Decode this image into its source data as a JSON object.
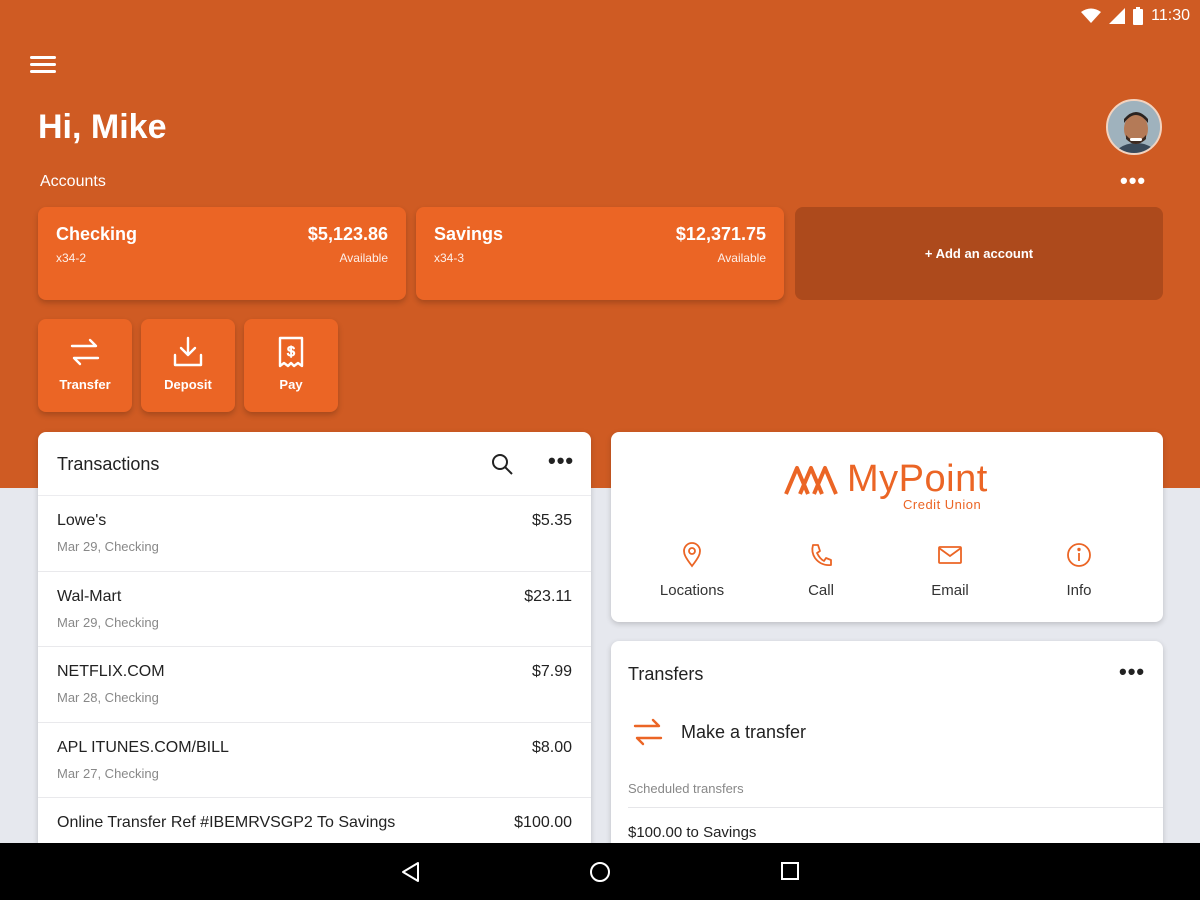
{
  "status_bar": {
    "time": "11:30",
    "icons": [
      "wifi-icon",
      "signal-icon",
      "battery-icon"
    ]
  },
  "header": {
    "greeting": "Hi, Mike",
    "menu_icon": "menu-icon",
    "avatar": "user-avatar"
  },
  "accounts": {
    "label": "Accounts",
    "more_icon": "more-horizontal-icon",
    "items": [
      {
        "name": "Checking",
        "number": "x34-2",
        "balance": "$5,123.86",
        "status": "Available"
      },
      {
        "name": "Savings",
        "number": "x34-3",
        "balance": "$12,371.75",
        "status": "Available"
      }
    ],
    "add_label": "+ Add an account"
  },
  "quick_actions": [
    {
      "label": "Transfer",
      "icon": "transfer-icon"
    },
    {
      "label": "Deposit",
      "icon": "deposit-icon"
    },
    {
      "label": "Pay",
      "icon": "bill-pay-icon"
    }
  ],
  "transactions": {
    "title": "Transactions",
    "items": [
      {
        "merchant": "Lowe's",
        "meta": "Mar 29, Checking",
        "amount": "$5.35"
      },
      {
        "merchant": "Wal-Mart",
        "meta": "Mar 29, Checking",
        "amount": "$23.11"
      },
      {
        "merchant": "NETFLIX.COM",
        "meta": "Mar 28, Checking",
        "amount": "$7.99"
      },
      {
        "merchant": "APL ITUNES.COM/BILL",
        "meta": "Mar 27, Checking",
        "amount": "$8.00"
      },
      {
        "merchant": "Online Transfer Ref #IBEMRVSGP2 To Savings",
        "meta": "",
        "amount": "$100.00"
      }
    ]
  },
  "credit_union": {
    "logo_name": "MyPoint",
    "logo_sub": "Credit Union",
    "actions": [
      {
        "label": "Locations",
        "icon": "location-pin-icon"
      },
      {
        "label": "Call",
        "icon": "phone-icon"
      },
      {
        "label": "Email",
        "icon": "email-icon"
      },
      {
        "label": "Info",
        "icon": "info-icon"
      }
    ]
  },
  "transfers": {
    "title": "Transfers",
    "make_transfer": "Make a transfer",
    "scheduled_label": "Scheduled transfers",
    "scheduled_items": [
      "$100.00 to Savings"
    ]
  },
  "colors": {
    "brand": "#cf5b23",
    "card": "#eb6525",
    "add_card": "#ad4a1c",
    "background": "#e6e8ee"
  },
  "nav_bar": {
    "buttons": [
      "back-icon",
      "home-icon",
      "recents-icon"
    ]
  }
}
